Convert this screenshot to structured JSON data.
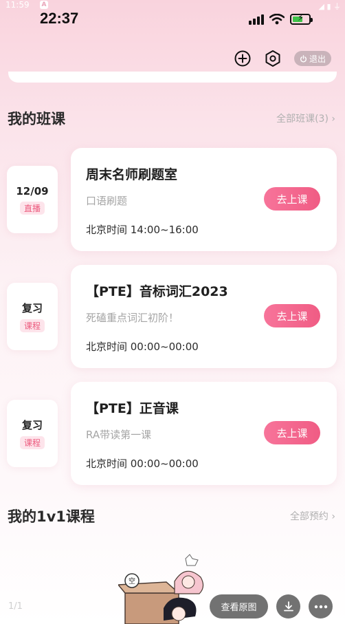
{
  "system_bar": {
    "time": "11:59",
    "badge": "A",
    "right_icons": "◢ ▮ ⏚"
  },
  "status_bar": {
    "time": "22:37"
  },
  "top_actions": {
    "add_icon": "plus-circle-icon",
    "settings_icon": "hexagon-settings-icon",
    "logout_label": "退出"
  },
  "my_classes": {
    "title": "我的班课",
    "all_link": "全部班课(3)",
    "courses": [
      {
        "tag_main": "12/09",
        "tag_sub": "直播",
        "title": "周末名师刷题室",
        "subtitle": "口语刷题",
        "time": "北京时间 14:00~16:00",
        "button": "去上课"
      },
      {
        "tag_main": "复习",
        "tag_sub": "课程",
        "title": "【PTE】音标词汇2023",
        "subtitle": "死磕重点词汇初阶！",
        "time": "北京时间 00:00~00:00",
        "button": "去上课"
      },
      {
        "tag_main": "复习",
        "tag_sub": "课程",
        "title": "【PTE】正音课",
        "subtitle": "RA带读第一课",
        "time": "北京时间 00:00~00:00",
        "button": "去上课"
      }
    ]
  },
  "one_on_one": {
    "title": "我的1v1课程",
    "all_link": "全部预约"
  },
  "viewer": {
    "page_counter": "1/1",
    "view_original": "查看原图",
    "download_icon": "download-icon",
    "more_icon": "more-dots-icon"
  },
  "colors": {
    "accent": "#f05c84",
    "tag_bg": "#fde4eb",
    "bg_top": "#f9d3dd"
  }
}
